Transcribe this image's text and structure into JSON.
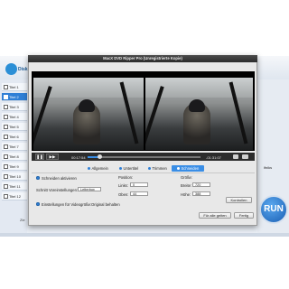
{
  "app": {
    "logo_text": "Disk",
    "bottom_text": "Zie",
    "run_label": "RUN",
    "titles": [
      "Titel 1",
      "Titel 2",
      "Titel 3",
      "Titel 4",
      "Titel 5",
      "Titel 6",
      "Titel 7",
      "Titel 8",
      "Titel 9",
      "Titel 10",
      "Titel 11",
      "Titel 12"
    ],
    "selected_title_index": 1,
    "right_partial": "ifniks"
  },
  "dialog": {
    "title": "MacX DVD Ripper Pro (Unregistrierte Kopie)",
    "player": {
      "time_current": "00:17:54",
      "time_total": "-01:31:07",
      "progress_fraction": 0.11,
      "play_symbol": "❚❚",
      "ff_symbol": "▶▶"
    },
    "tabs": [
      {
        "label": "Allgemein",
        "active": false
      },
      {
        "label": "Untertitel",
        "active": false
      },
      {
        "label": "Trimmen",
        "active": false
      },
      {
        "label": "Schneiden",
        "active": true
      }
    ],
    "crop": {
      "enable_label": "Schneiden aktivieren",
      "preset_label": "Schnitt Voreinstellungen:",
      "preset_value": "Letterbox",
      "video_settings_label": "Einstellungen für Videogröße:",
      "video_settings_value": "Original behalten",
      "position_label": "Position:",
      "left_label": "Links:",
      "left_value": "0",
      "top_label": "Oben:",
      "top_value": "44",
      "size_label": "Größe:",
      "width_label": "Breite:",
      "width_value": "720",
      "height_label": "Höhe:",
      "height_value": "388"
    },
    "buttons": {
      "reset": "Kontrollen",
      "apply_all": "Für alle gelten",
      "done": "Fertig"
    }
  },
  "colors": {
    "accent": "#3a8ee6",
    "title_bar": "#2c2c2c",
    "selection": "#2f7fd6"
  }
}
